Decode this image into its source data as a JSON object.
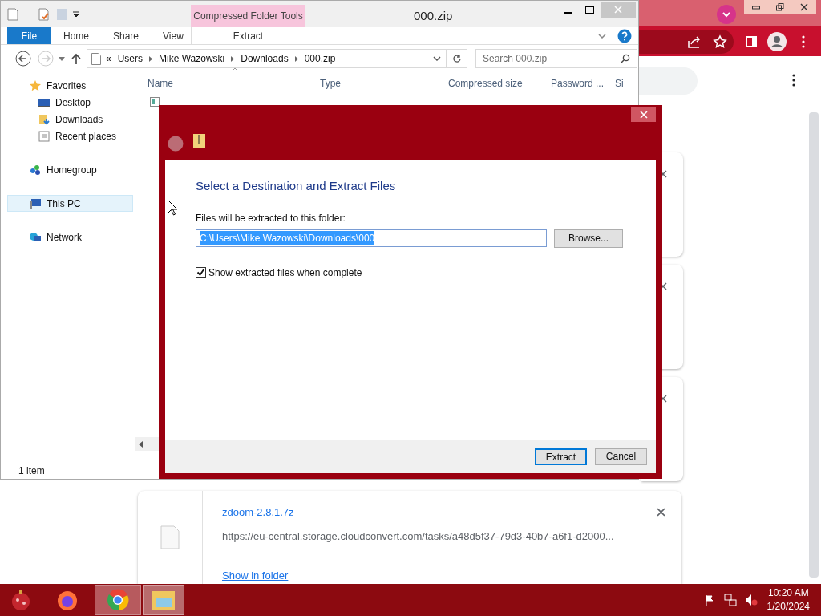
{
  "explorer": {
    "title": "000.zip",
    "context_label": "Compressed Folder Tools",
    "ribbon_tabs": [
      {
        "label": "File",
        "kind": "file",
        "selected": false
      },
      {
        "label": "Home",
        "kind": "tab",
        "selected": false
      },
      {
        "label": "Share",
        "kind": "tab",
        "selected": false
      },
      {
        "label": "View",
        "kind": "tab",
        "selected": false
      },
      {
        "label": "Extract",
        "kind": "context",
        "selected": false
      }
    ],
    "breadcrumb": [
      "«",
      "Users",
      "Mike Wazowski",
      "Downloads",
      "000.zip"
    ],
    "search_placeholder": "Search 000.zip",
    "columns": [
      "Name",
      "Type",
      "Compressed size",
      "Password ...",
      "Si"
    ],
    "nav": [
      {
        "label": "Favorites",
        "kind": "star",
        "selected": false,
        "children": [
          {
            "label": "Desktop",
            "kind": "desktop",
            "selected": false
          },
          {
            "label": "Downloads",
            "kind": "downloads",
            "selected": false
          },
          {
            "label": "Recent places",
            "kind": "recent",
            "selected": false
          }
        ]
      },
      {
        "label": "Homegroup",
        "kind": "homegroup",
        "selected": false
      },
      {
        "label": "This PC",
        "kind": "pc",
        "selected": true
      },
      {
        "label": "Network",
        "kind": "network",
        "selected": false
      }
    ],
    "status": "1 item"
  },
  "dialog": {
    "heading": "Select a Destination and Extract Files",
    "folder_label": "Files will be extracted to this folder:",
    "path": {
      "value": "C:\\Users\\Mike Wazowski\\Downloads\\000",
      "selected": true
    },
    "browse": "Browse...",
    "show_files": {
      "label": "Show extracted files when complete",
      "checked": true
    },
    "buttons": [
      {
        "label": "Extract",
        "default": true
      },
      {
        "label": "Cancel",
        "default": false
      }
    ]
  },
  "download": {
    "filename": "zdoom-2.8.1.7z",
    "url": "https://eu-central.storage.cloudconvert.com/tasks/a48d5f37-79d3-40b7-a6f1-d2000...",
    "action": "Show in folder"
  },
  "taskbar": {
    "time": "10:20 AM",
    "date": "1/20/2024"
  }
}
